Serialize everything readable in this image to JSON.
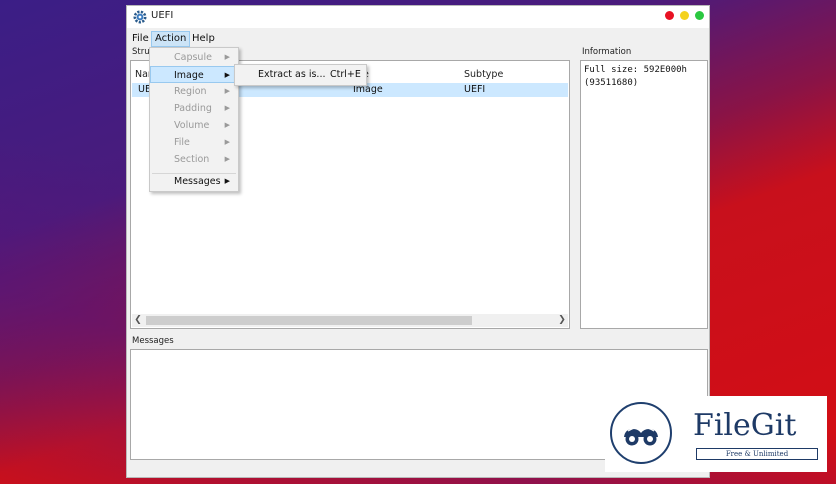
{
  "window": {
    "title": "UEFI"
  },
  "menubar": {
    "items": [
      "File",
      "Action",
      "Help"
    ]
  },
  "structure": {
    "label": "Stru",
    "columns": [
      "Nam",
      "pe",
      "Subtype"
    ],
    "row": {
      "name": "UE",
      "type": "Image",
      "subtype": "UEFI"
    }
  },
  "information": {
    "label": "Information",
    "lines": [
      "Full size: 592E000h",
      "(93511680)"
    ]
  },
  "messages": {
    "label": "Messages"
  },
  "action_menu": {
    "items": [
      {
        "label": "Capsule",
        "enabled": false
      },
      {
        "label": "Image",
        "enabled": true,
        "highlighted": true
      },
      {
        "label": "Region",
        "enabled": false
      },
      {
        "label": "Padding",
        "enabled": false
      },
      {
        "label": "Volume",
        "enabled": false
      },
      {
        "label": "File",
        "enabled": false
      },
      {
        "label": "Section",
        "enabled": false
      },
      {
        "label": "Messages",
        "enabled": true
      }
    ]
  },
  "image_submenu": {
    "label": "Extract as is...",
    "shortcut": "Ctrl+E"
  },
  "watermark": {
    "name": "FileGit",
    "tagline": "Free & Unlimited"
  },
  "colors": {
    "close": "#e81123",
    "minimize": "#f4d21f",
    "maximize": "#2bc840",
    "selection": "#cce8ff",
    "menu_highlight": "#cce4f7",
    "brand": "#1e3a66"
  },
  "icons": {
    "app": "gear-icon",
    "submenu_arrow": "triangle-right-icon",
    "scroll_left": "chevron-left-icon",
    "scroll_right": "chevron-right-icon"
  }
}
